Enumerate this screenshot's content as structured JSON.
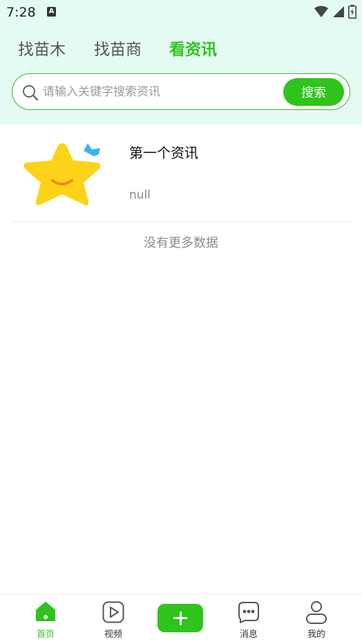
{
  "status_bar": {
    "time": "7:28",
    "notification_icon": "a-icon",
    "icons": [
      "wifi-icon",
      "signal-icon",
      "battery-charging-icon"
    ]
  },
  "tabs": [
    {
      "label": "找苗木",
      "active": false
    },
    {
      "label": "找苗商",
      "active": false
    },
    {
      "label": "看资讯",
      "active": true
    }
  ],
  "search": {
    "placeholder": "请输入关键字搜索资讯",
    "value": "",
    "button_label": "搜索"
  },
  "news": {
    "items": [
      {
        "title": "第一个资讯",
        "summary": "null",
        "thumbnail": "star-icon"
      }
    ],
    "end_message": "没有更多数据"
  },
  "bottom_nav": {
    "items": [
      {
        "label": "首页",
        "icon": "home-icon",
        "active": true
      },
      {
        "label": "视频",
        "icon": "play-icon",
        "active": false
      },
      {
        "label": "",
        "icon": "plus-icon",
        "active": false
      },
      {
        "label": "消息",
        "icon": "message-icon",
        "active": false
      },
      {
        "label": "我的",
        "icon": "user-icon",
        "active": false
      }
    ]
  },
  "colors": {
    "accent": "#2ec41c",
    "header_bg": "#e3fbf2",
    "inactive_text": "#555555",
    "muted_text": "#8c8c8c"
  }
}
